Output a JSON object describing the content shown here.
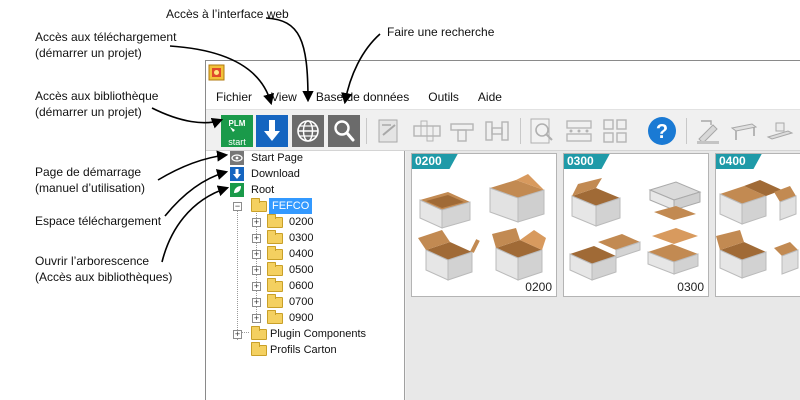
{
  "annotations": {
    "web": "Accès à l’interface web",
    "search": "Faire une recherche",
    "download_1": "Accès aux téléchargement",
    "download_2": "(démarrer un projet)",
    "library_1": "Accès aux bibliothèque",
    "library_2": "(démarrer un projet)",
    "startpage_1": "Page de démarrage",
    "startpage_2": "(manuel d’utilisation)",
    "download_space": "Espace téléchargement",
    "tree_1": "Ouvrir l’arborescence",
    "tree_2": "(Accès aux bibliothèques)"
  },
  "menu": [
    "Fichier",
    "View",
    "Base de données",
    "Outils",
    "Aide"
  ],
  "toolbar": {
    "start_top": "PLM",
    "start_bottom": "start",
    "help_glyph": "?"
  },
  "tree": {
    "start_page": "Start Page",
    "download": "Download",
    "root": "Root",
    "fefco": "FEFCO",
    "children": [
      "0200",
      "0300",
      "0400",
      "0500",
      "0600",
      "0700",
      "0900"
    ],
    "plugin": "Plugin Components",
    "profils": "Profils Carton"
  },
  "cards": [
    {
      "badge": "0200",
      "code": "0200"
    },
    {
      "badge": "0300",
      "code": "0300"
    },
    {
      "badge": "0400",
      "code": ""
    }
  ],
  "colors": {
    "accent_teal": "#1f9aa8",
    "start_green": "#1a9a4a",
    "download_blue": "#1565c0",
    "help_blue": "#1a7ad4",
    "box_kraft": "#c28a52",
    "box_white": "#e6e6e6",
    "selection": "#3399ff"
  }
}
